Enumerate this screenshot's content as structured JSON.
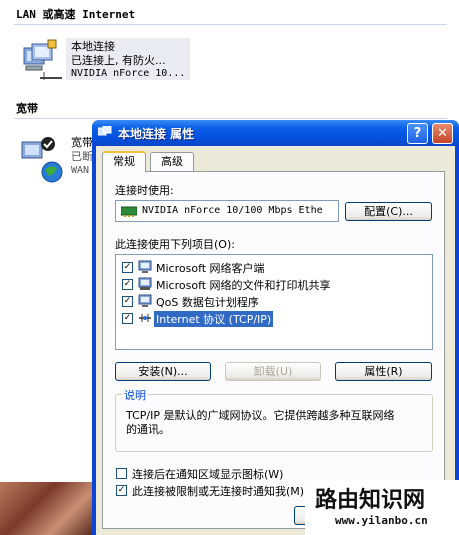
{
  "background": {
    "section_lan": "LAN 或高速 Internet",
    "lan_conn": {
      "name": "本地连接",
      "status": "已连接上, 有防火...",
      "device": "NVIDIA nForce 10..."
    },
    "section_broadband": "宽带",
    "broadband_conn": {
      "name": "宽带",
      "status": "已断",
      "device": "WAN"
    }
  },
  "dialog": {
    "title": "本地连接 属性",
    "help_button": "?",
    "close_button": "✕",
    "tabs": [
      {
        "label": "常规",
        "active": true
      },
      {
        "label": "高级",
        "active": false
      }
    ],
    "connect_using_label": "连接时使用:",
    "adapter_name": "NVIDIA nForce 10/100 Mbps Ethe",
    "configure_button": "配置(C)...",
    "items_label": "此连接使用下列项目(O):",
    "items": [
      {
        "label": "Microsoft 网络客户端",
        "checked": true,
        "icon": "network-client-icon"
      },
      {
        "label": "Microsoft 网络的文件和打印机共享",
        "checked": true,
        "icon": "file-printer-share-icon"
      },
      {
        "label": "QoS 数据包计划程序",
        "checked": true,
        "icon": "qos-scheduler-icon"
      },
      {
        "label": "Internet 协议 (TCP/IP)",
        "checked": true,
        "icon": "protocol-icon",
        "selected": true
      }
    ],
    "install_button": "安装(N)...",
    "uninstall_button": "卸载(U)",
    "properties_button": "属性(R)",
    "description_legend": "说明",
    "description_text_line1": "TCP/IP 是默认的广域网协议。它提供跨越多种互联网络",
    "description_text_line2": "的通讯。",
    "show_icon_checkbox": {
      "label": "连接后在通知区域显示图标(W)",
      "checked": false
    },
    "notify_checkbox": {
      "label": "此连接被限制或无连接时通知我(M)",
      "checked": true
    }
  },
  "watermark": {
    "title": "路由知识网",
    "url": "www.yilanbo.cn"
  }
}
